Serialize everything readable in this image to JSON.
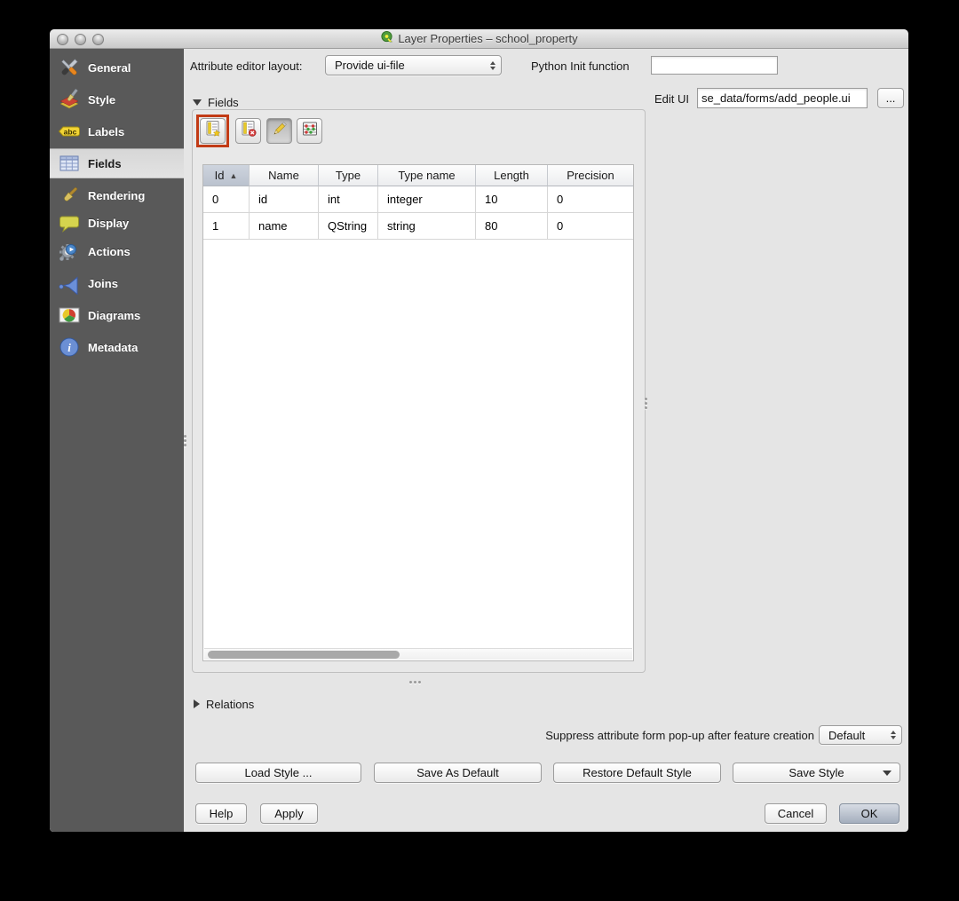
{
  "colors": {
    "highlight_ring": "#c23b16",
    "sidebar_bg": "#595959",
    "selected_item_bg": "#dcdcdc",
    "window_bg": "#e5e5e5",
    "sorted_header_bg": "#c5ccd6"
  },
  "window": {
    "title": "Layer Properties – school_property",
    "app_icon": "qgis-icon"
  },
  "sidebar": {
    "selected": "Fields",
    "items": [
      {
        "label": "General",
        "icon": "tools-icon"
      },
      {
        "label": "Style",
        "icon": "style-brush-icon"
      },
      {
        "label": "Labels",
        "icon": "abc-label-icon"
      },
      {
        "label": "Fields",
        "icon": "fields-table-icon"
      },
      {
        "label": "Rendering",
        "icon": "rendering-brush-icon"
      },
      {
        "label": "Display",
        "icon": "speech-bubble-icon"
      },
      {
        "label": "Actions",
        "icon": "gear-action-icon"
      },
      {
        "label": "Joins",
        "icon": "join-icon"
      },
      {
        "label": "Diagrams",
        "icon": "diagram-icon"
      },
      {
        "label": "Metadata",
        "icon": "info-icon"
      }
    ]
  },
  "attribute_editor": {
    "label": "Attribute editor layout:",
    "value": "Provide ui-file"
  },
  "python_init": {
    "label": "Python Init function",
    "value": ""
  },
  "edit_ui": {
    "label": "Edit UI",
    "value": "se_data/forms/add_people.ui",
    "browse_label": "..."
  },
  "fields_section": {
    "title": "Fields",
    "toolbar": [
      {
        "name": "new-attribute-button",
        "icon": "new-column-icon",
        "highlighted": true
      },
      {
        "name": "delete-attribute-button",
        "icon": "delete-column-icon"
      },
      {
        "name": "toggle-editing-button",
        "icon": "pencil-icon",
        "pressed": true
      },
      {
        "name": "field-calculator-button",
        "icon": "abacus-icon"
      }
    ],
    "table": {
      "columns": [
        "Id",
        "Name",
        "Type",
        "Type name",
        "Length",
        "Precision"
      ],
      "sort_column": "Id",
      "sort_indicator": "▲",
      "rows": [
        [
          "0",
          "id",
          "int",
          "integer",
          "10",
          "0"
        ],
        [
          "1",
          "name",
          "QString",
          "string",
          "80",
          "0"
        ]
      ]
    }
  },
  "relations_section": {
    "title": "Relations"
  },
  "suppress": {
    "label": "Suppress attribute form pop-up after feature creation",
    "value": "Default"
  },
  "style_buttons": {
    "load": "Load Style ...",
    "save_as_default": "Save As Default",
    "restore_default": "Restore Default Style",
    "save_style": "Save Style"
  },
  "dialog_buttons": {
    "help": "Help",
    "apply": "Apply",
    "cancel": "Cancel",
    "ok": "OK"
  }
}
